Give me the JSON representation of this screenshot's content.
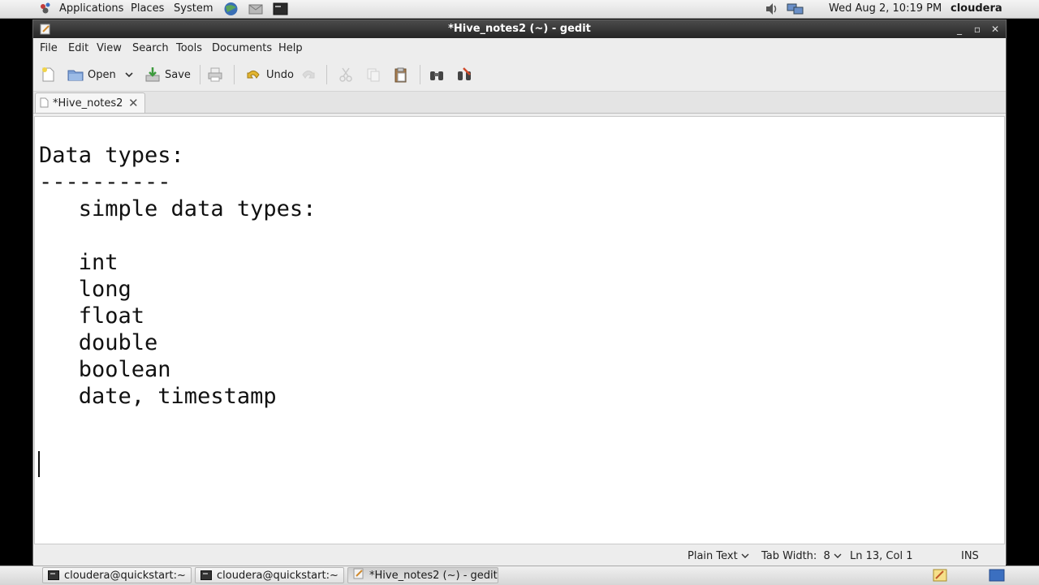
{
  "top_panel": {
    "menus": [
      "Applications",
      "Places",
      "System"
    ],
    "clock": "Wed Aug  2, 10:19 PM",
    "user": "cloudera",
    "icons": [
      "applications-logo-icon",
      "browser-icon",
      "mail-icon",
      "terminal-launcher-icon",
      "volume-icon",
      "network-icon"
    ]
  },
  "window": {
    "title": "*Hive_notes2 (~) - gedit",
    "wm_buttons": [
      "_",
      "▫",
      "✕"
    ]
  },
  "menubar": [
    "File",
    "Edit",
    "View",
    "Search",
    "Tools",
    "Documents",
    "Help"
  ],
  "toolbar": {
    "open_label": "Open",
    "save_label": "Save",
    "undo_label": "Undo"
  },
  "tab": {
    "label": "*Hive_notes2",
    "close": "✕"
  },
  "document": {
    "lines": [
      "Data types:",
      "----------",
      "   simple data types:",
      "",
      "   int",
      "   long",
      "   float",
      "   double",
      "   boolean",
      "   date, timestamp",
      "",
      ""
    ]
  },
  "statusbar": {
    "language": "Plain Text",
    "tab_width": "Tab Width:  8",
    "position": "Ln 13, Col 1",
    "mode": "INS"
  },
  "taskbar": {
    "items": [
      "cloudera@quickstart:~",
      "cloudera@quickstart:~",
      "*Hive_notes2 (~) - gedit"
    ]
  },
  "colors": {
    "titlebar": "#2f2f2f",
    "panel": "#e6e6e6",
    "editor_bg": "#ffffff"
  }
}
